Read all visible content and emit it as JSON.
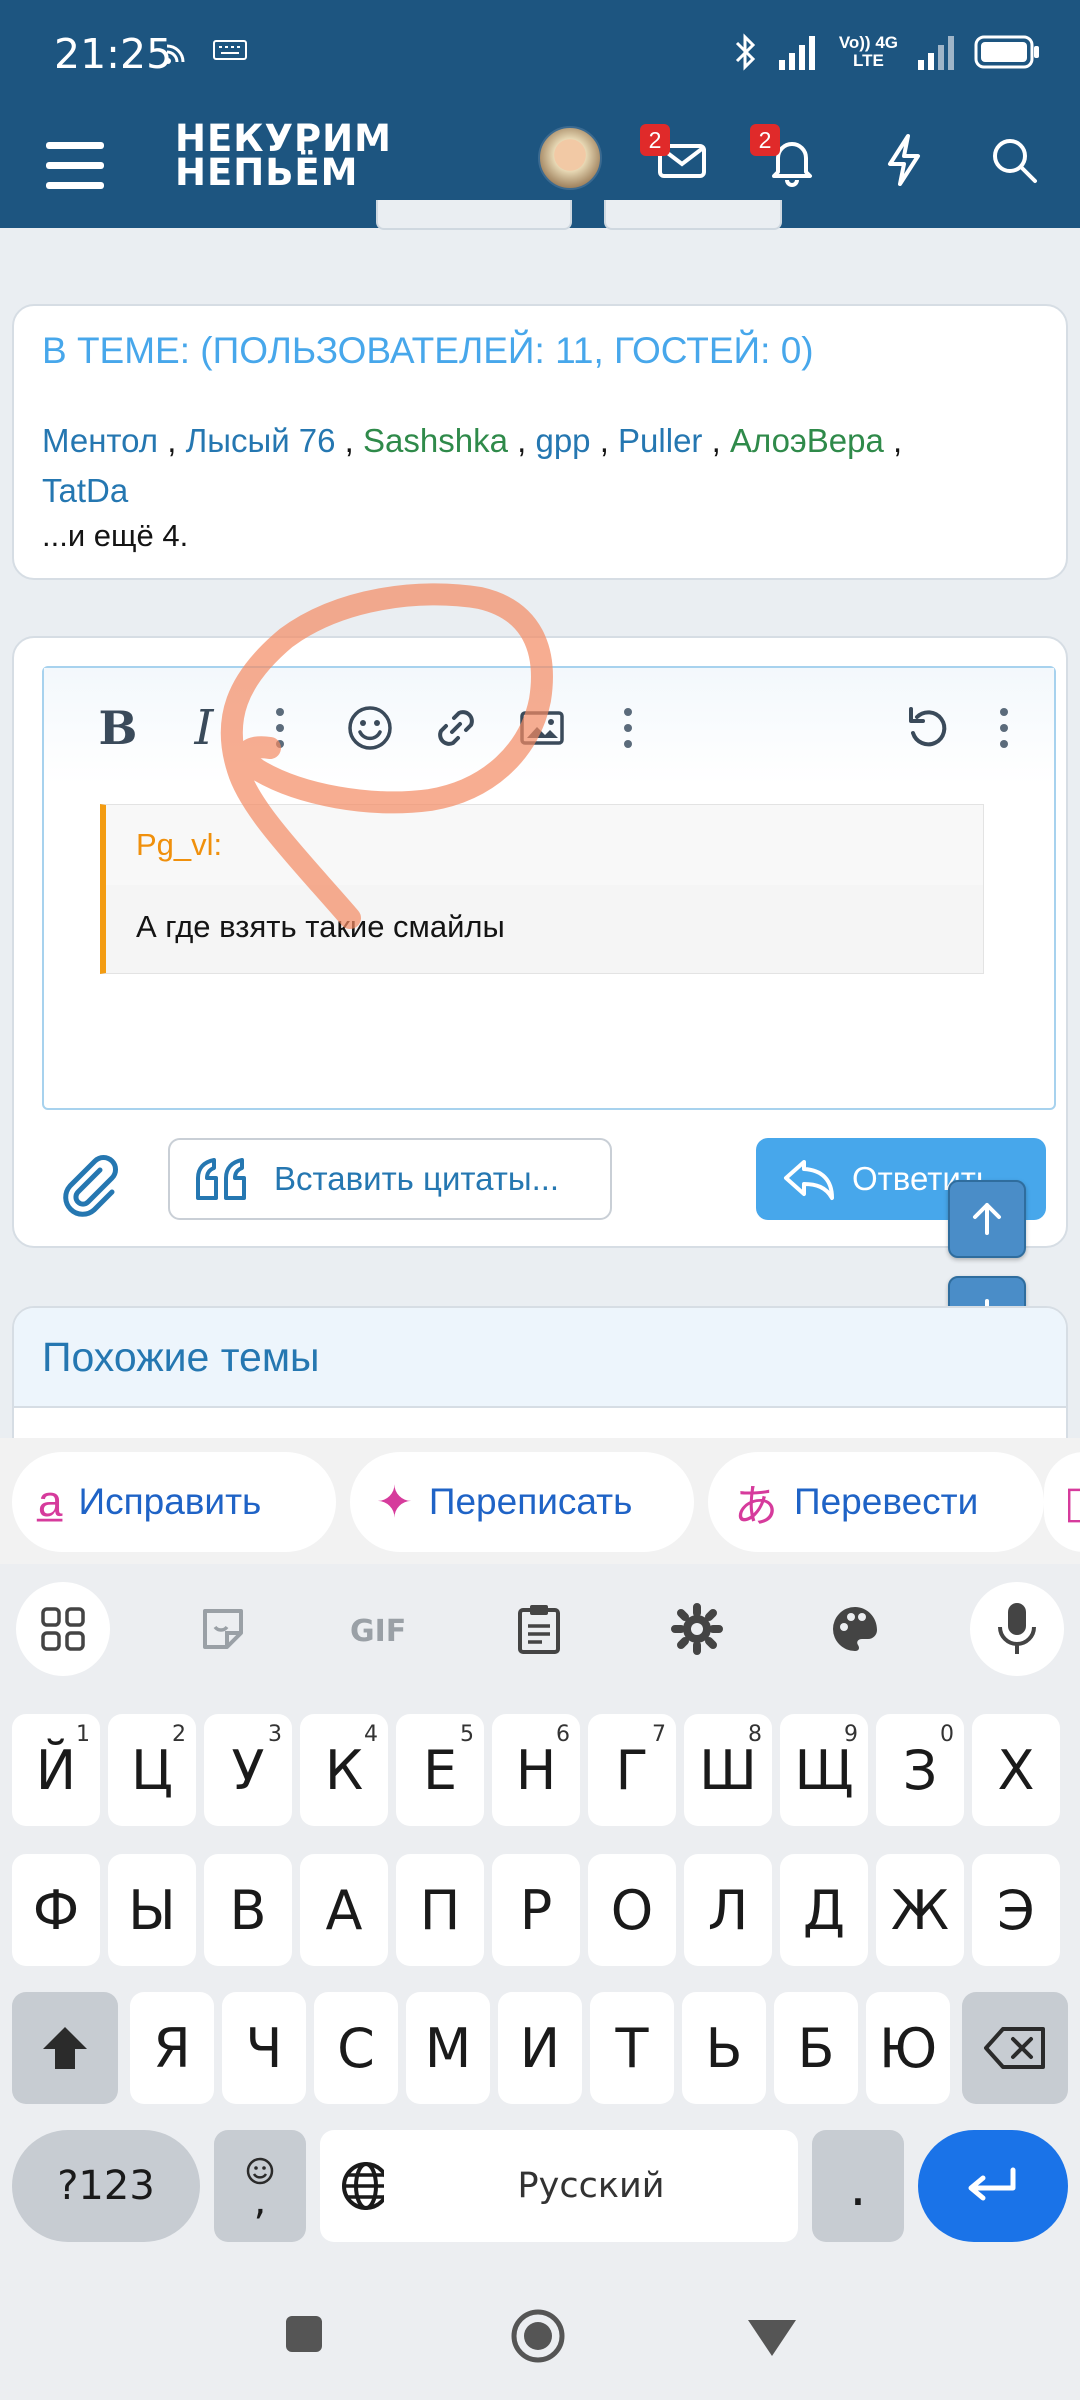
{
  "status_bar": {
    "time": "21:25",
    "network_top": "Vo)) 4G",
    "network_bottom": "LTE"
  },
  "header": {
    "logo_line1": "НЕКУРИМ",
    "logo_line2": "НЕПЬЁМ",
    "messages_badge": "2",
    "alerts_badge": "2",
    "colors": {
      "background": "#1d5580",
      "badge": "#e02a2a"
    }
  },
  "online": {
    "title": "В ТЕМЕ: (ПОЛЬЗОВАТЕЛЕЙ: 11, ГОСТЕЙ: 0)",
    "users": [
      {
        "name": "Ментол",
        "color": "blue"
      },
      {
        "name": "Лысый 76",
        "color": "blue"
      },
      {
        "name": "Sashshka",
        "color": "green"
      },
      {
        "name": "gpp",
        "color": "blue"
      },
      {
        "name": "Puller",
        "color": "blue"
      },
      {
        "name": "АлоэВера",
        "color": "green"
      },
      {
        "name": "TatDa",
        "color": "blue"
      }
    ],
    "separator": " , ",
    "trailing": " ,",
    "more": "...и ещё 4."
  },
  "editor": {
    "toolbar": {
      "bold": "B",
      "italic": "I",
      "icons": [
        "more-vertical-icon",
        "smiley-icon",
        "link-icon",
        "image-icon",
        "more-vertical-icon",
        "undo-icon",
        "more-vertical-icon"
      ]
    },
    "quote": {
      "author": "Pg_vl:",
      "text": "А где взять такие смайлы"
    },
    "insert_quotes_label": "Вставить цитаты...",
    "reply_label": "Ответить"
  },
  "similar": {
    "title": "Похожие темы"
  },
  "suggestions": [
    {
      "label": "Исправить",
      "icon": "spellcheck-icon",
      "icon_color": "#d63b9c"
    },
    {
      "label": "Переписать",
      "icon": "sparkle-icon",
      "icon_color": "#d63b9c"
    },
    {
      "label": "Перевести",
      "icon": "translate-icon",
      "icon_color": "#d63b9c"
    }
  ],
  "keyboard": {
    "row1": [
      {
        "k": "Й",
        "n": "1"
      },
      {
        "k": "Ц",
        "n": "2"
      },
      {
        "k": "У",
        "n": "3"
      },
      {
        "k": "К",
        "n": "4"
      },
      {
        "k": "Е",
        "n": "5"
      },
      {
        "k": "Н",
        "n": "6"
      },
      {
        "k": "Г",
        "n": "7"
      },
      {
        "k": "Ш",
        "n": "8"
      },
      {
        "k": "Щ",
        "n": "9"
      },
      {
        "k": "З",
        "n": "0"
      },
      {
        "k": "Х",
        "n": ""
      }
    ],
    "row2": [
      "Ф",
      "Ы",
      "В",
      "А",
      "П",
      "Р",
      "О",
      "Л",
      "Д",
      "Ж",
      "Э"
    ],
    "row3": [
      "Я",
      "Ч",
      "С",
      "М",
      "И",
      "Т",
      "Ь",
      "Б",
      "Ю"
    ],
    "symbols_label": "?123",
    "comma_label": ",",
    "space_label": "Русский",
    "period_label": ".",
    "accent_color": "#1a73e8"
  }
}
